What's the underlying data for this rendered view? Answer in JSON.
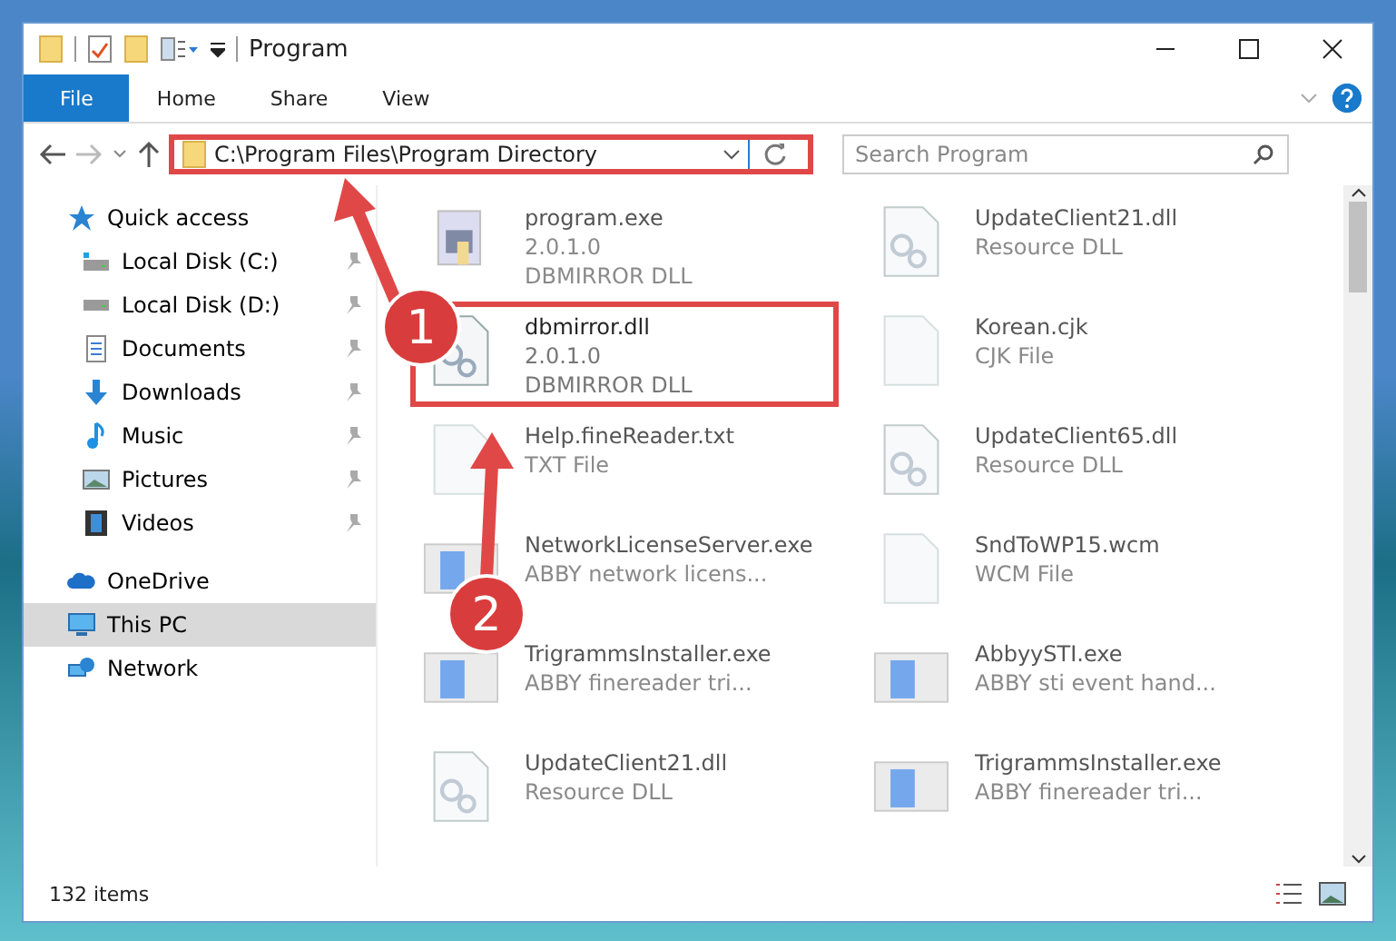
{
  "window": {
    "title": "Program"
  },
  "ribbon_tabs": [
    {
      "label": "File",
      "selected": true
    },
    {
      "label": "Home",
      "selected": false
    },
    {
      "label": "Share",
      "selected": false
    },
    {
      "label": "View",
      "selected": false
    }
  ],
  "address_bar": {
    "path": "C:\\Program Files\\Program Directory",
    "highlighted": true
  },
  "search": {
    "placeholder": "Search Program"
  },
  "sidebar": {
    "items": [
      {
        "label": "Quick access",
        "kind": "quick",
        "selected": false,
        "children": [
          {
            "label": "Local Disk (C:)",
            "kind": "disk_c",
            "pinned": true
          },
          {
            "label": "Local Disk (D:)",
            "kind": "disk",
            "pinned": true
          },
          {
            "label": "Documents",
            "kind": "documents",
            "pinned": true
          },
          {
            "label": "Downloads",
            "kind": "downloads",
            "pinned": true
          },
          {
            "label": "Music",
            "kind": "music",
            "pinned": true
          },
          {
            "label": "Pictures",
            "kind": "pictures",
            "pinned": true
          },
          {
            "label": "Videos",
            "kind": "videos",
            "pinned": true
          }
        ]
      },
      {
        "label": "OneDrive",
        "kind": "cloud",
        "selected": false
      },
      {
        "label": "This PC",
        "kind": "pc",
        "selected": true
      },
      {
        "label": "Network",
        "kind": "network",
        "selected": false
      }
    ]
  },
  "files": [
    {
      "name": "program.exe",
      "details": [
        "2.0.1.0",
        "DBMIRROR DLL"
      ],
      "kind": "app",
      "highlighted": false
    },
    {
      "name": "UpdateClient21.dll",
      "details": [
        "Resource DLL"
      ],
      "kind": "settings",
      "highlighted": false
    },
    {
      "name": "dbmirror.dll",
      "details": [
        "2.0.1.0",
        "DBMIRROR DLL"
      ],
      "kind": "settings",
      "highlighted": true
    },
    {
      "name": "Korean.cjk",
      "details": [
        "CJK File"
      ],
      "kind": "blank",
      "highlighted": false
    },
    {
      "name": "Help.fineReader.txt",
      "details": [
        "TXT File"
      ],
      "kind": "blank",
      "highlighted": false
    },
    {
      "name": "UpdateClient65.dll",
      "details": [
        "Resource DLL"
      ],
      "kind": "settings",
      "highlighted": false
    },
    {
      "name": "NetworkLicenseServer.exe",
      "details": [
        "ABBY network licens..."
      ],
      "kind": "installer",
      "highlighted": false
    },
    {
      "name": "SndToWP15.wcm",
      "details": [
        "WCM File"
      ],
      "kind": "blank",
      "highlighted": false
    },
    {
      "name": "TrigrammsInstaller.exe",
      "details": [
        "ABBY finereader tri..."
      ],
      "kind": "installer",
      "highlighted": false
    },
    {
      "name": "AbbyySTI.exe",
      "details": [
        "ABBY sti event hand..."
      ],
      "kind": "installer",
      "highlighted": false
    },
    {
      "name": "UpdateClient21.dll",
      "details": [
        "Resource DLL"
      ],
      "kind": "settings",
      "highlighted": false
    },
    {
      "name": "TrigrammsInstaller.exe",
      "details": [
        "ABBY finereader tri..."
      ],
      "kind": "installer",
      "highlighted": false
    }
  ],
  "status_bar": {
    "count": "132 items"
  },
  "annotations": [
    {
      "label": "1"
    },
    {
      "label": "2"
    }
  ]
}
